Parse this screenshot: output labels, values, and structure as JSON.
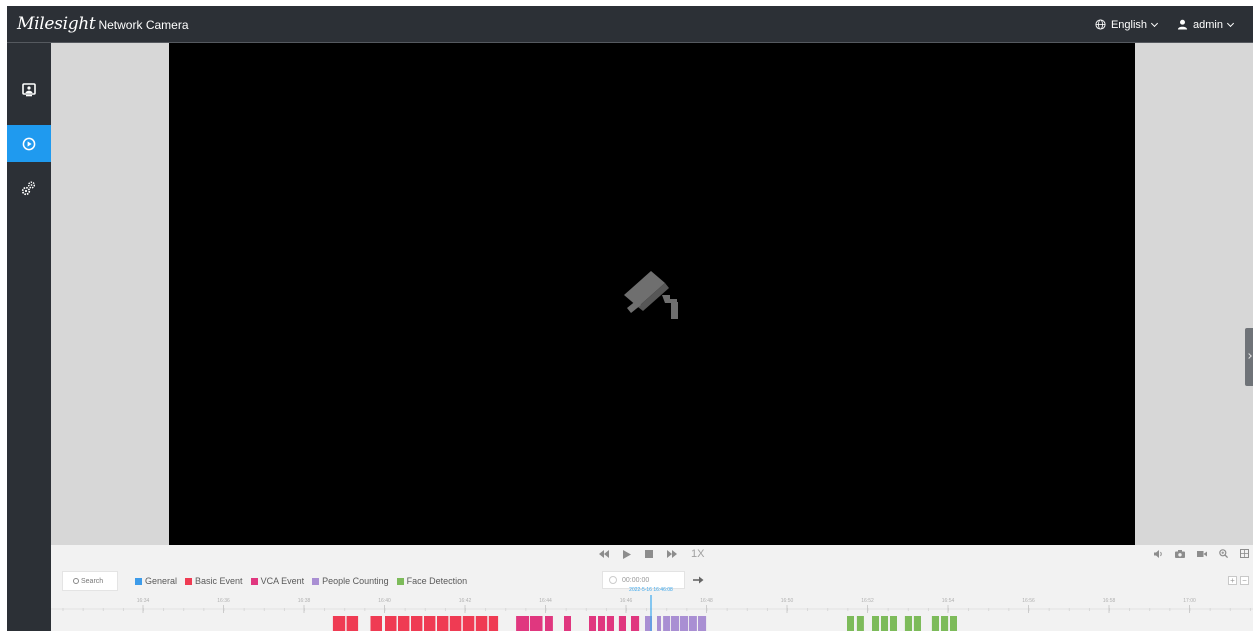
{
  "header": {
    "logo_text": "Milesight",
    "product": "Network Camera",
    "language": "English",
    "user": "admin"
  },
  "sidebar": {
    "items": [
      {
        "name": "live-view",
        "icon": "monitor-icon",
        "active": false
      },
      {
        "name": "playback",
        "icon": "play-circle-icon",
        "active": true
      },
      {
        "name": "settings",
        "icon": "gears-icon",
        "active": false
      }
    ]
  },
  "playback_controls": {
    "speed": "1X",
    "buttons": [
      "rewind-icon",
      "play-icon",
      "stop-icon",
      "fast-forward-icon"
    ]
  },
  "toolbar_right": [
    "volume-icon",
    "snapshot-icon",
    "record-icon",
    "zoom-icon",
    "fullscreen-icon"
  ],
  "search": {
    "label": "Search"
  },
  "legend": [
    {
      "label": "General",
      "color": "#3d9be9"
    },
    {
      "label": "Basic Event",
      "color": "#ef3b53"
    },
    {
      "label": "VCA Event",
      "color": "#e0377f"
    },
    {
      "label": "People Counting",
      "color": "#a98fd3"
    },
    {
      "label": "Face Detection",
      "color": "#7dbb5a"
    }
  ],
  "time_input": {
    "value": "00:00:00"
  },
  "zoom": {
    "in": "+",
    "out": "−"
  },
  "timeline": {
    "cursor_label": "2022-5-16 16:46:08",
    "ticks": [
      "16:34",
      "16:36",
      "16:38",
      "16:40",
      "16:42",
      "16:44",
      "16:46",
      "16:48",
      "16:50",
      "16:52",
      "16:54",
      "16:56",
      "16:58",
      "17:00"
    ],
    "event_blocks": [
      {
        "type": "Basic Event",
        "color": "#ef3b53",
        "start": 0.2345,
        "end": 0.2447
      },
      {
        "type": "Basic Event",
        "color": "#ef3b53",
        "start": 0.2459,
        "end": 0.2555
      },
      {
        "type": "Basic Event",
        "color": "#ef3b53",
        "start": 0.2658,
        "end": 0.2754
      },
      {
        "type": "Basic Event",
        "color": "#ef3b53",
        "start": 0.2779,
        "end": 0.2875
      },
      {
        "type": "Basic Event",
        "color": "#ef3b53",
        "start": 0.2887,
        "end": 0.2982
      },
      {
        "type": "Basic Event",
        "color": "#ef3b53",
        "start": 0.2995,
        "end": 0.309
      },
      {
        "type": "Basic Event",
        "color": "#ef3b53",
        "start": 0.3103,
        "end": 0.3198
      },
      {
        "type": "Basic Event",
        "color": "#ef3b53",
        "start": 0.3211,
        "end": 0.3306
      },
      {
        "type": "Basic Event",
        "color": "#ef3b53",
        "start": 0.3318,
        "end": 0.3414
      },
      {
        "type": "Basic Event",
        "color": "#ef3b53",
        "start": 0.3426,
        "end": 0.3522
      },
      {
        "type": "Basic Event",
        "color": "#ef3b53",
        "start": 0.3534,
        "end": 0.363
      },
      {
        "type": "Basic Event",
        "color": "#ef3b53",
        "start": 0.3642,
        "end": 0.3719
      },
      {
        "type": "VCA Event",
        "color": "#e0377f",
        "start": 0.3869,
        "end": 0.3977
      },
      {
        "type": "VCA Event",
        "color": "#e0377f",
        "start": 0.3985,
        "end": 0.4089
      },
      {
        "type": "VCA Event",
        "color": "#e0377f",
        "start": 0.411,
        "end": 0.4176
      },
      {
        "type": "VCA Event",
        "color": "#e0377f",
        "start": 0.4268,
        "end": 0.4326
      },
      {
        "type": "VCA Event",
        "color": "#e0377f",
        "start": 0.4476,
        "end": 0.4534
      },
      {
        "type": "VCA Event",
        "color": "#e0377f",
        "start": 0.4551,
        "end": 0.4609
      },
      {
        "type": "VCA Event",
        "color": "#e0377f",
        "start": 0.4625,
        "end": 0.4684
      },
      {
        "type": "VCA Event",
        "color": "#e0377f",
        "start": 0.4725,
        "end": 0.4784
      },
      {
        "type": "VCA Event",
        "color": "#e0377f",
        "start": 0.4825,
        "end": 0.4892
      },
      {
        "type": "People Counting",
        "color": "#a98fd3",
        "start": 0.4942,
        "end": 0.5
      },
      {
        "type": "People Counting",
        "color": "#a98fd3",
        "start": 0.5042,
        "end": 0.5075
      },
      {
        "type": "People Counting",
        "color": "#a98fd3",
        "start": 0.5092,
        "end": 0.515
      },
      {
        "type": "People Counting",
        "color": "#a98fd3",
        "start": 0.5158,
        "end": 0.5225
      },
      {
        "type": "People Counting",
        "color": "#a98fd3",
        "start": 0.5233,
        "end": 0.53
      },
      {
        "type": "People Counting",
        "color": "#a98fd3",
        "start": 0.5308,
        "end": 0.5374
      },
      {
        "type": "People Counting",
        "color": "#a98fd3",
        "start": 0.5383,
        "end": 0.545
      },
      {
        "type": "Face Detection",
        "color": "#7dbb5a",
        "start": 0.6622,
        "end": 0.668
      },
      {
        "type": "Face Detection",
        "color": "#7dbb5a",
        "start": 0.6705,
        "end": 0.6763
      },
      {
        "type": "Face Detection",
        "color": "#7dbb5a",
        "start": 0.683,
        "end": 0.6888
      },
      {
        "type": "Face Detection",
        "color": "#7dbb5a",
        "start": 0.6905,
        "end": 0.6963
      },
      {
        "type": "Face Detection",
        "color": "#7dbb5a",
        "start": 0.698,
        "end": 0.7038
      },
      {
        "type": "Face Detection",
        "color": "#7dbb5a",
        "start": 0.7104,
        "end": 0.7163
      },
      {
        "type": "Face Detection",
        "color": "#7dbb5a",
        "start": 0.7179,
        "end": 0.7238
      },
      {
        "type": "Face Detection",
        "color": "#7dbb5a",
        "start": 0.7329,
        "end": 0.7388
      },
      {
        "type": "Face Detection",
        "color": "#7dbb5a",
        "start": 0.7404,
        "end": 0.7463
      },
      {
        "type": "Face Detection",
        "color": "#7dbb5a",
        "start": 0.7479,
        "end": 0.7537
      }
    ]
  }
}
